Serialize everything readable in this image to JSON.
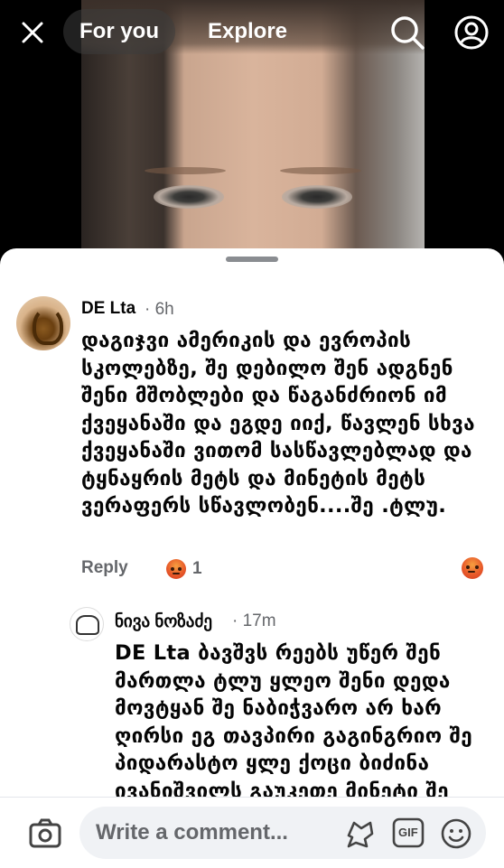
{
  "header": {
    "tabs": [
      {
        "label": "For you",
        "active": true
      },
      {
        "label": "Explore",
        "active": false
      }
    ],
    "icons": [
      "close-icon",
      "search-icon",
      "profile-icon"
    ]
  },
  "comments": [
    {
      "author": "DE Lta",
      "time": "· 6h",
      "text": "დაგიჯვი ამერიკის და ევროპის სკოლებზე, შე დებილო შენ ადგნენ შენი მშობლები და წაგანძრიონ იმ ქვეყანაში და ეგდე იიქ, წავლენ სხვა ქვეყანაში ვითომ სასწავლებლად და ტყნაყრის მეტს და მინეტის მეტს ვერაფერს სწავლობენ....შე .ტლუ.",
      "reply_label": "Reply",
      "reaction_count": "1",
      "reaction_icon": "angry-reaction-icon"
    }
  ],
  "reply": {
    "author": "ნივა ნოზაძე",
    "time": "· 17m",
    "text": "DE Lta ბავშვს რეებს უწერ შენ მართლა ტლუ ყლეო შენი დედა მოვტყან შე ნაბიჭვარო არ ხარ ღირსი ეგ თავპირი გაგინგრიო შე პიდარასტო ყლე ქოცი ბიძინა ივანიშვილს გაუკეთე მინეტი შე"
  },
  "composer": {
    "placeholder": "Write a comment...",
    "icons": [
      "camera-icon",
      "sticker-icon",
      "gif-icon",
      "emoji-icon"
    ],
    "gif_label": "GIF"
  },
  "colors": {
    "secondary_text": "#65676b",
    "sheet_bg": "#ffffff",
    "input_bg": "#f0f2f5"
  }
}
